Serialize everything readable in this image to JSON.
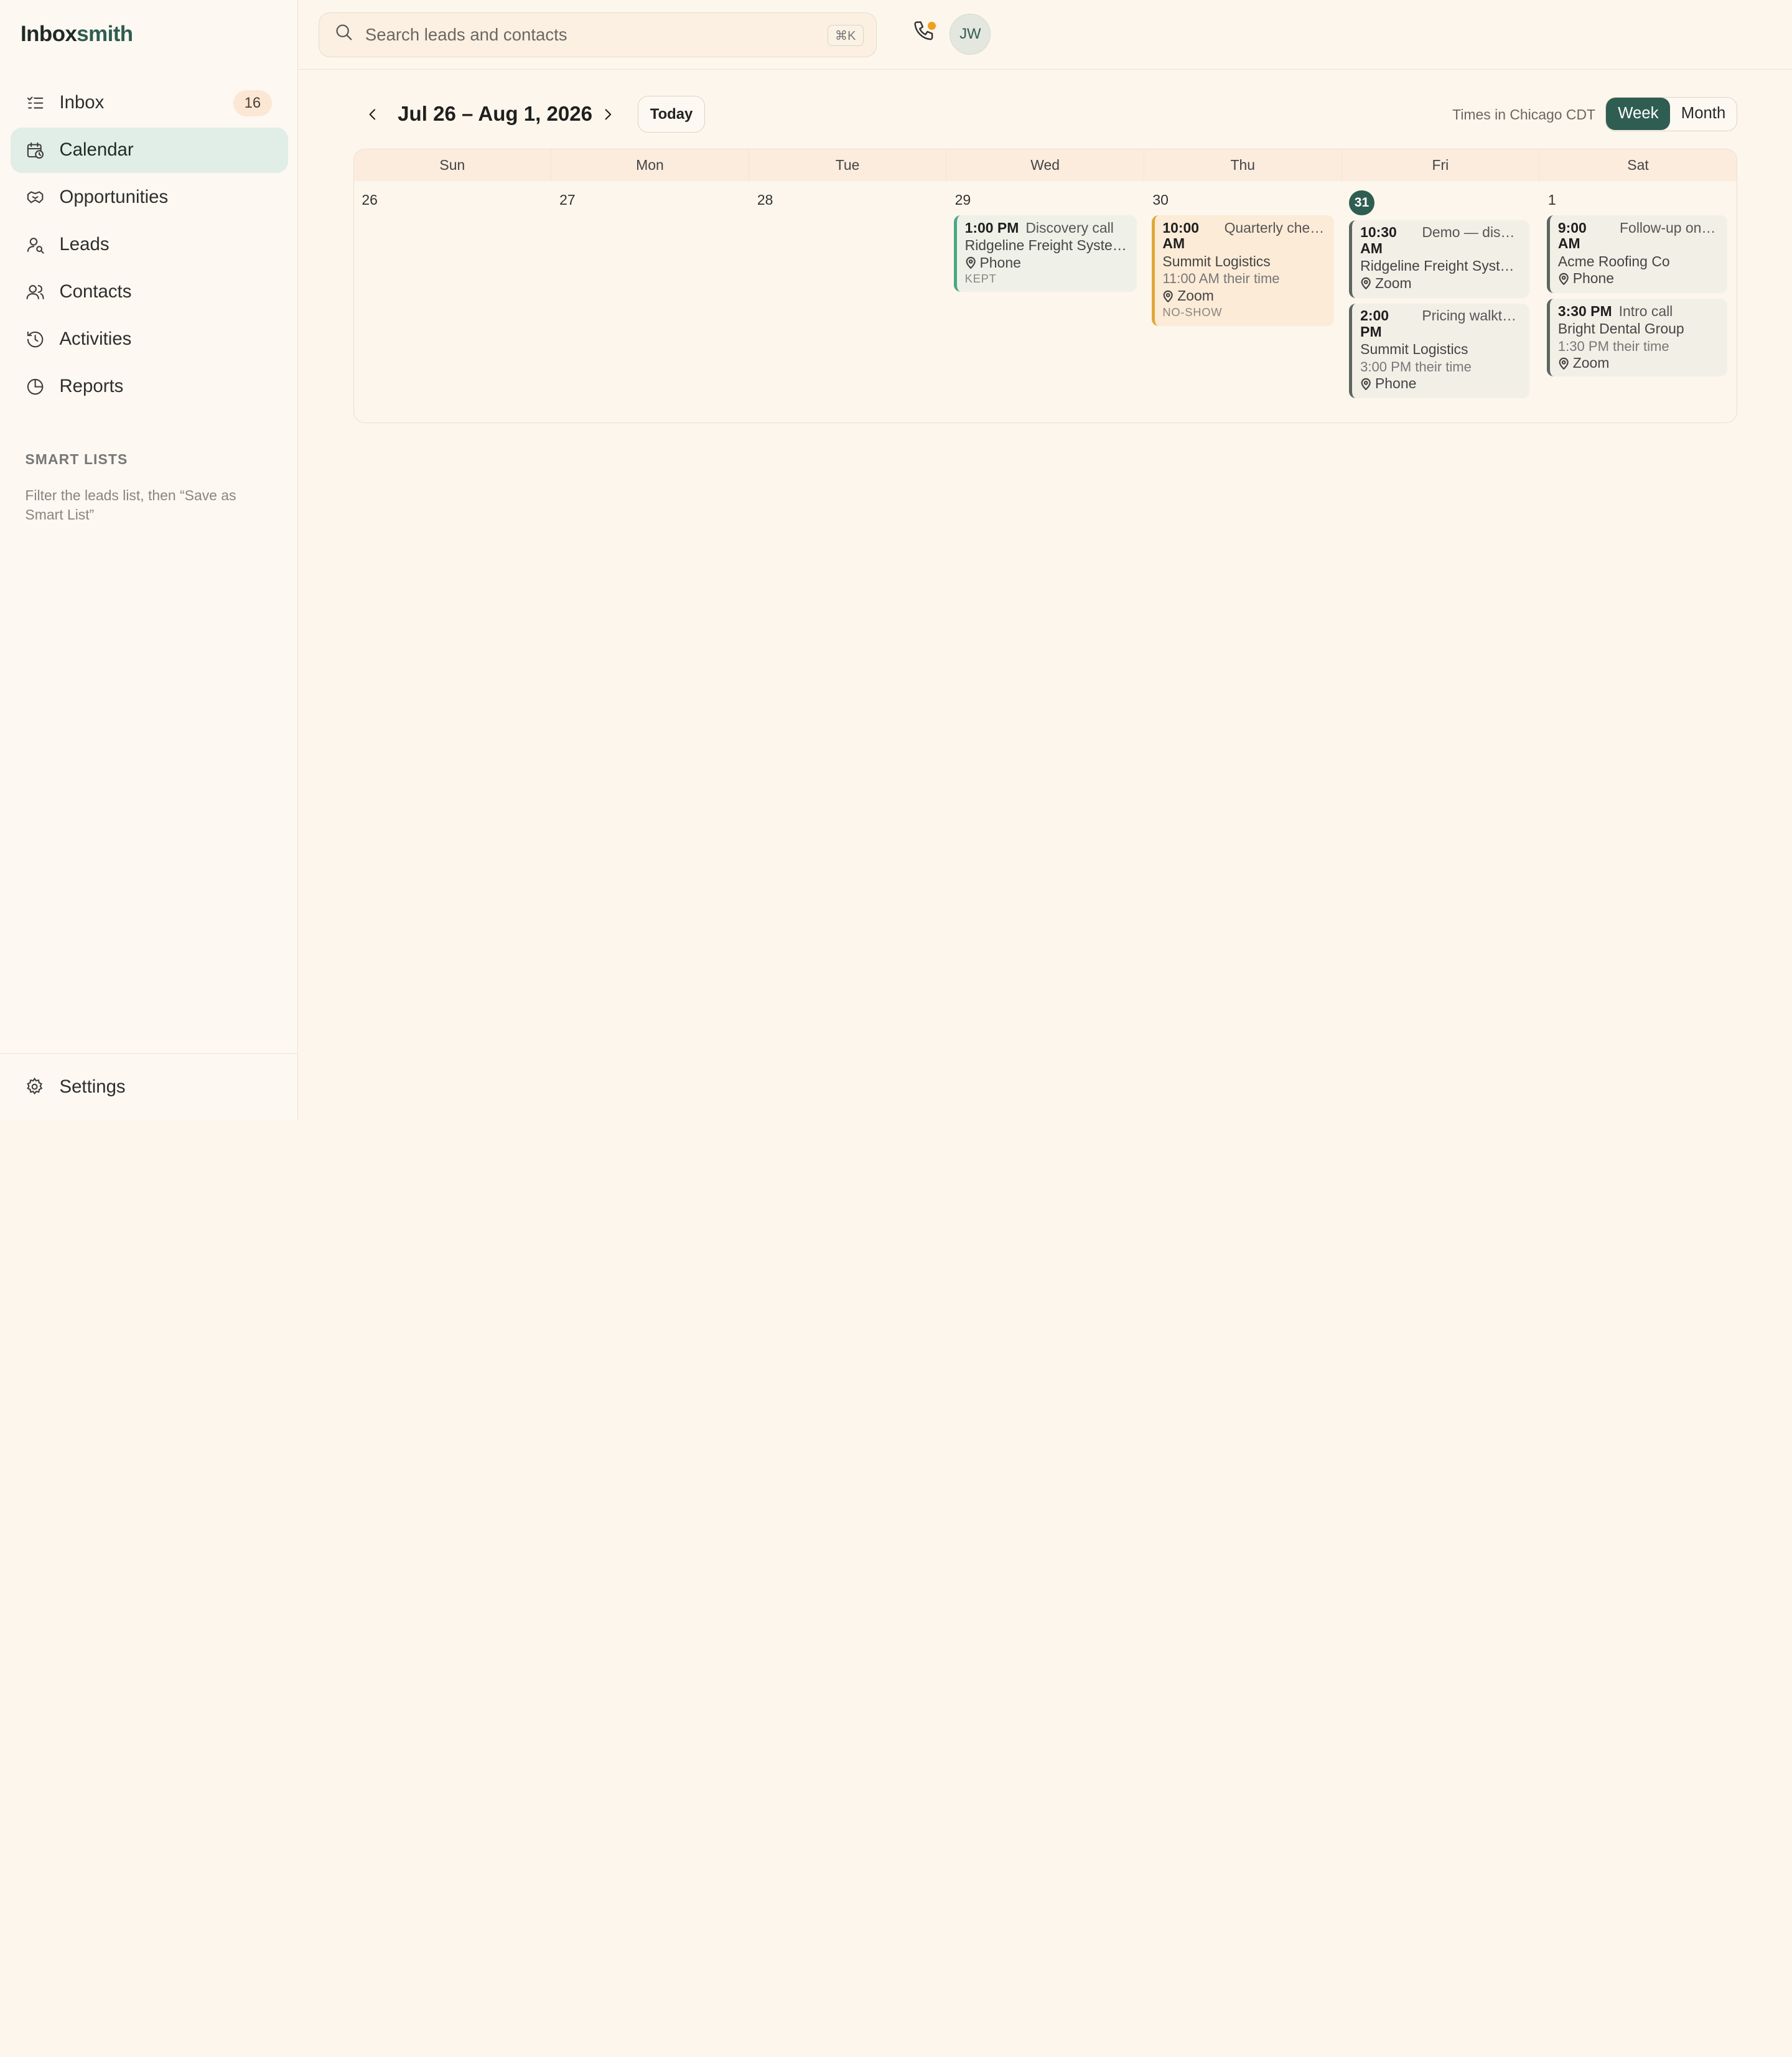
{
  "app": {
    "name_part1": "Inbox",
    "name_part2": "smith"
  },
  "sidebar": {
    "items": [
      {
        "label": "Inbox",
        "badge": "16",
        "icon": "list-check-icon"
      },
      {
        "label": "Calendar",
        "icon": "calendar-clock-icon",
        "active": true
      },
      {
        "label": "Opportunities",
        "icon": "handshake-icon"
      },
      {
        "label": "Leads",
        "icon": "user-search-icon"
      },
      {
        "label": "Contacts",
        "icon": "users-icon"
      },
      {
        "label": "Activities",
        "icon": "history-icon"
      },
      {
        "label": "Reports",
        "icon": "pie-chart-icon"
      }
    ],
    "smart_lists_title": "SMART LISTS",
    "smart_lists_hint": "Filter the leads list, then “Save as Smart List”",
    "settings_label": "Settings"
  },
  "topbar": {
    "search_placeholder": "Search leads and contacts",
    "shortcut": "⌘K",
    "avatar_initials": "JW"
  },
  "calendar": {
    "range": "Jul 26 – Aug 1, 2026",
    "today_label": "Today",
    "timezone_note": "Times in Chicago CDT",
    "view_week": "Week",
    "view_month": "Month",
    "active_view": "Week",
    "days_of_week": [
      "Sun",
      "Mon",
      "Tue",
      "Wed",
      "Thu",
      "Fri",
      "Sat"
    ],
    "dates": [
      "26",
      "27",
      "28",
      "29",
      "30",
      "31",
      "1"
    ],
    "today_date": "31",
    "events": {
      "wed": {
        "time": "1:00 PM",
        "title": "Discovery call",
        "company": "Ridgeline Freight Systems",
        "location": "Phone",
        "status": "KEPT"
      },
      "thu": {
        "time": "10:00 AM",
        "title": "Quarterly check-in",
        "company": "Summit Logistics",
        "their_time": "11:00 AM their time",
        "location": "Zoom",
        "status": "NO-SHOW"
      },
      "fri1": {
        "time": "10:30 AM",
        "title": "Demo — dispatch",
        "company": "Ridgeline Freight Systems",
        "location": "Zoom"
      },
      "fri2": {
        "time": "2:00 PM",
        "title": "Pricing walkthrough",
        "company": "Summit Logistics",
        "their_time": "3:00 PM their time",
        "location": "Phone"
      },
      "sat1": {
        "time": "9:00 AM",
        "title": "Follow-up on the proposal",
        "company": "Acme Roofing Co",
        "location": "Phone"
      },
      "sat2": {
        "time": "3:30 PM",
        "title": "Intro call",
        "company": "Bright Dental Group",
        "their_time": "1:30 PM their time",
        "location": "Zoom"
      }
    }
  },
  "colors": {
    "accent": "#2f5d52",
    "kept": "#49a784",
    "no_show": "#e0a83a",
    "badge_bg": "#fbe7d3"
  }
}
